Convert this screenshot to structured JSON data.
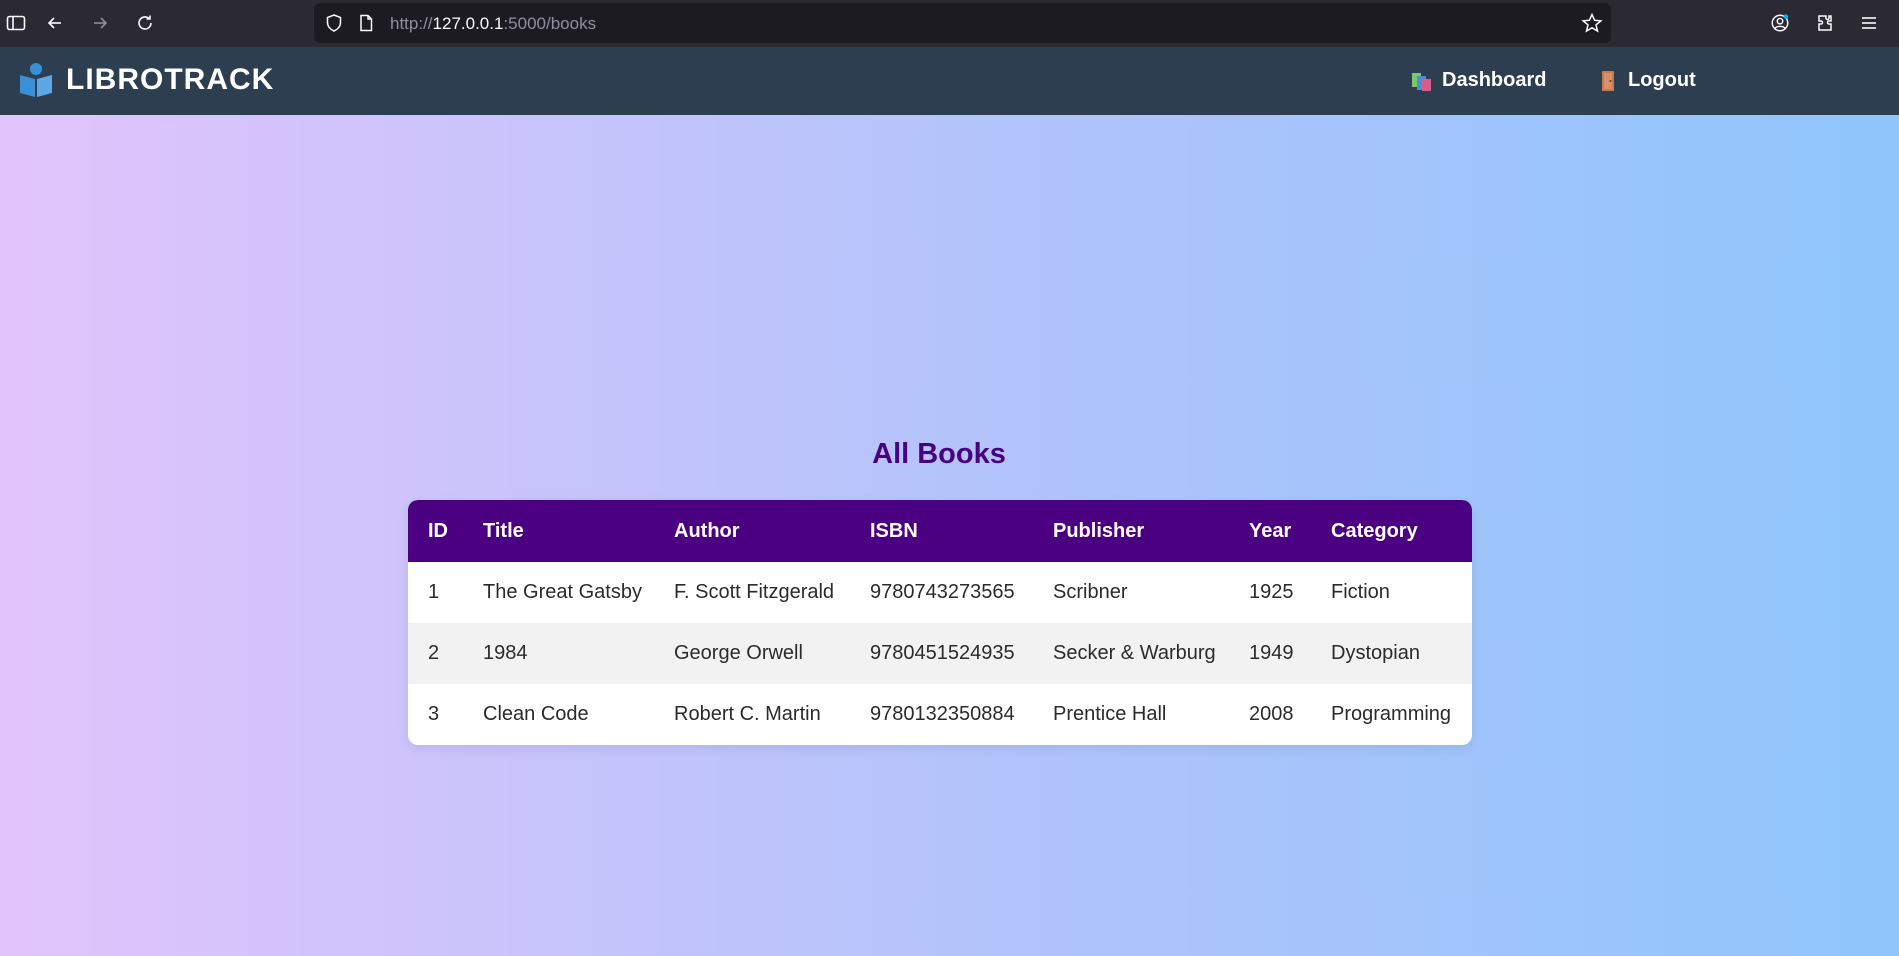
{
  "browser": {
    "url_prefix": "http://",
    "url_host": "127.0.0.1",
    "url_rest": ":5000/books"
  },
  "app": {
    "brand": "LIBROTRACK",
    "nav": {
      "dashboard": "Dashboard",
      "logout": "Logout"
    }
  },
  "page": {
    "title": "All Books"
  },
  "table": {
    "headers": {
      "id": "ID",
      "title": "Title",
      "author": "Author",
      "isbn": "ISBN",
      "publisher": "Publisher",
      "year": "Year",
      "category": "Category"
    },
    "rows": [
      {
        "id": "1",
        "title": "The Great Gatsby",
        "author": "F. Scott Fitzgerald",
        "isbn": "9780743273565",
        "publisher": "Scribner",
        "year": "1925",
        "category": "Fiction"
      },
      {
        "id": "2",
        "title": "1984",
        "author": "George Orwell",
        "isbn": "9780451524935",
        "publisher": "Secker & Warburg",
        "year": "1949",
        "category": "Dystopian"
      },
      {
        "id": "3",
        "title": "Clean Code",
        "author": "Robert C. Martin",
        "isbn": "9780132350884",
        "publisher": "Prentice Hall",
        "year": "2008",
        "category": "Programming"
      }
    ]
  },
  "colors": {
    "header_bg": "#2c3e50",
    "accent": "#4b0082",
    "gradient_left": "#e1c4fb",
    "gradient_right": "#8ec5fb"
  }
}
